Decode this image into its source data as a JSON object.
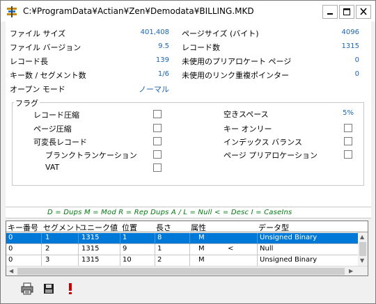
{
  "window": {
    "title": "C:¥ProgramData¥Actian¥Zen¥Demodata¥BILLING.MKD"
  },
  "fileinfo": {
    "left": [
      {
        "label": "ファイル サイズ",
        "value": "401,408"
      },
      {
        "label": "ファイル バージョン",
        "value": "9.5"
      },
      {
        "label": "レコード長",
        "value": "139"
      },
      {
        "label": "キー数 / セグメント数",
        "value": "1/6"
      },
      {
        "label": "オープン モード",
        "value": "ノーマル"
      }
    ],
    "right": [
      {
        "label": "ページサイズ (バイト)",
        "value": "4096"
      },
      {
        "label": "レコード数",
        "value": "1315"
      },
      {
        "label": "未使用のプリアロケート ページ",
        "value": "0"
      },
      {
        "label": "未使用のリンク重複ポインター",
        "value": "0"
      }
    ]
  },
  "flags": {
    "legend": "フラグ",
    "left": [
      {
        "label": "レコード圧縮"
      },
      {
        "label": "ページ圧縮"
      },
      {
        "label": "可変長レコード"
      },
      {
        "label": "ブランクトランケーション"
      },
      {
        "label": "VAT"
      }
    ],
    "right_free_space_label": "空きスペース",
    "right_free_space_value": "5%",
    "right": [
      {
        "label": "キー オンリー"
      },
      {
        "label": "インデックス バランス"
      },
      {
        "label": "ページ プリアロケーション"
      }
    ]
  },
  "legend_line": "D = Dups    M = Mod    R = Rep  Dups    A / L = Null    < = Desc    I = CaseIns",
  "grid": {
    "headers": [
      "キー番号",
      "セグメント",
      "ユニーク値",
      "位置",
      "長さ",
      "属性",
      "データ型"
    ],
    "rows": [
      [
        "0",
        "1",
        "1315",
        "1",
        "8",
        "M",
        "",
        "Unsigned Binary"
      ],
      [
        "0",
        "2",
        "1315",
        "9",
        "1",
        "M",
        "<",
        "Null"
      ],
      [
        "0",
        "3",
        "1315",
        "10",
        "2",
        "M",
        "",
        "Unsigned Binary"
      ]
    ],
    "selected_row": 0
  },
  "toolbar": {
    "icons": [
      "print-icon",
      "save-icon",
      "exclamation-icon"
    ]
  },
  "colors": {
    "value_blue": "#1a63b5",
    "legend_green": "#007a10",
    "selection": "#0078d7"
  }
}
